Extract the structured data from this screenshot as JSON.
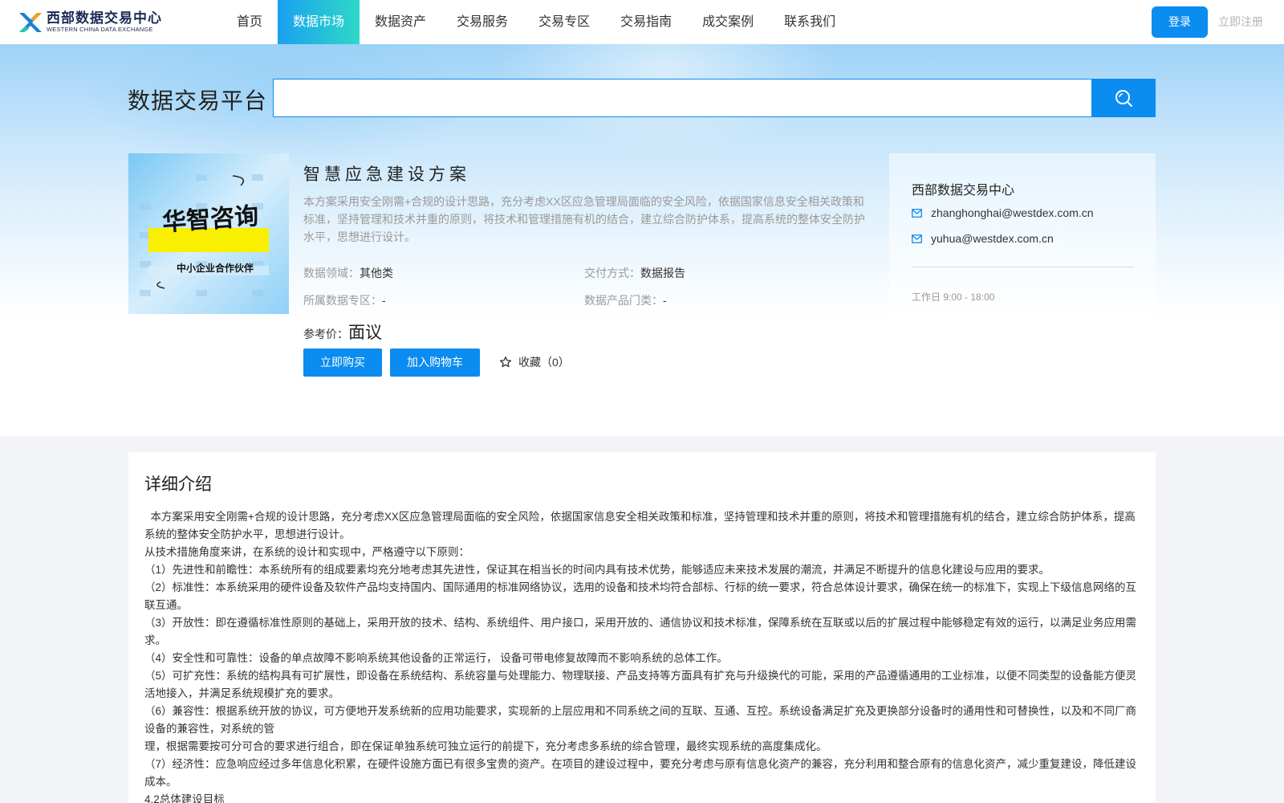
{
  "header": {
    "logo_cn": "西部数据交易中心",
    "logo_en": "WESTERN CHINA DATA EXCHANGE",
    "nav": [
      "首页",
      "数据市场",
      "数据资产",
      "交易服务",
      "交易专区",
      "交易指南",
      "成交案例",
      "联系我们"
    ],
    "active_nav": "数据市场",
    "login_label": "登录",
    "register_label": "立即注册"
  },
  "search": {
    "platform_title": "数据交易平台",
    "value": ""
  },
  "product": {
    "image_caption": "华智咨询",
    "image_subcaption": "中小企业合作伙伴",
    "name": "智慧应急建设方案",
    "description": "本方案采用安全刚需+合规的设计思路，充分考虑XX区应急管理局面临的安全风险，依据国家信息安全相关政策和标准，坚持管理和技术并重的原则，将技术和管理措施有机的结合，建立综合防护体系，提高系统的整体安全防护水平，思想进行设计。",
    "meta": {
      "domain_label": "数据领域：",
      "domain_value": "其他类",
      "delivery_label": "交付方式：",
      "delivery_value": "数据报告",
      "zone_label": "所属数据专区：",
      "zone_value": "-",
      "category_label": "数据产品门类：",
      "category_value": "-"
    },
    "price_label": "参考价：",
    "price_value": "面议",
    "buy_label": "立即购买",
    "cart_label": "加入购物车",
    "favorite_label": "收藏（0）"
  },
  "contact": {
    "title": "西部数据交易中心",
    "email1": "zhanghonghai@westdex.com.cn",
    "email2": "yuhua@westdex.com.cn",
    "hours": "工作日 9:00 - 18:00"
  },
  "detail": {
    "title": "详细介绍",
    "paragraphs": [
      "  本方案采用安全刚需+合规的设计思路，充分考虑XX区应急管理局面临的安全风险，依据国家信息安全相关政策和标准，坚持管理和技术并重的原则，将技术和管理措施有机的结合，建立综合防护体系，提高系统的整体安全防护水平，思想进行设计。",
      "从技术措施角度来讲，在系统的设计和实现中，严格遵守以下原则：",
      "（1）先进性和前瞻性：本系统所有的组成要素均充分地考虑其先进性，保证其在相当长的时间内具有技术优势，能够适应未来技术发展的潮流，并满足不断提升的信息化建设与应用的要求。",
      "（2）标准性：本系统采用的硬件设备及软件产品均支持国内、国际通用的标准网络协议，选用的设备和技术均符合部标、行标的统一要求，符合总体设计要求，确保在统一的标准下，实现上下级信息网络的互联互通。",
      "（3）开放性：即在遵循标准性原则的基础上，采用开放的技术、结构、系统组件、用户接口，采用开放的、通信协议和技术标准，保障系统在互联或以后的扩展过程中能够稳定有效的运行，以满足业务应用需求。",
      "（4）安全性和可靠性：设备的单点故障不影响系统其他设备的正常运行， 设备可带电修复故障而不影响系统的总体工作。",
      "（5）可扩充性：系统的结构具有可扩展性，即设备在系统结构、系统容量与处理能力、物理联接、产品支持等方面具有扩充与升级换代的可能，采用的产品遵循通用的工业标准，以便不同类型的设备能方便灵活地接入，并满足系统规模扩充的要求。",
      "（6）兼容性：根据系统开放的协议，可方便地开发系统新的应用功能要求，实现新的上层应用和不同系统之间的互联、互通、互控。系统设备满足扩充及更换部分设备时的通用性和可替换性，以及和不同厂商设备的兼容性，对系统的管",
      "理，根据需要按可分可合的要求进行组合，即在保证单独系统可独立运行的前提下，充分考虑多系统的综合管理，最终实现系统的高度集成化。",
      "（7）经济性：应急响应经过多年信息化积累，在硬件设施方面已有很多宝贵的资产。在项目的建设过程中，要充分考虑与原有信息化资产的兼容，充分利用和整合原有的信息化资产，减少重复建设，降低建设成本。",
      "4.2总体建设目标"
    ]
  },
  "colors": {
    "primary": "#0b8cf0",
    "nav_active_start": "#1aa1f0",
    "nav_active_end": "#2ed8c8"
  }
}
